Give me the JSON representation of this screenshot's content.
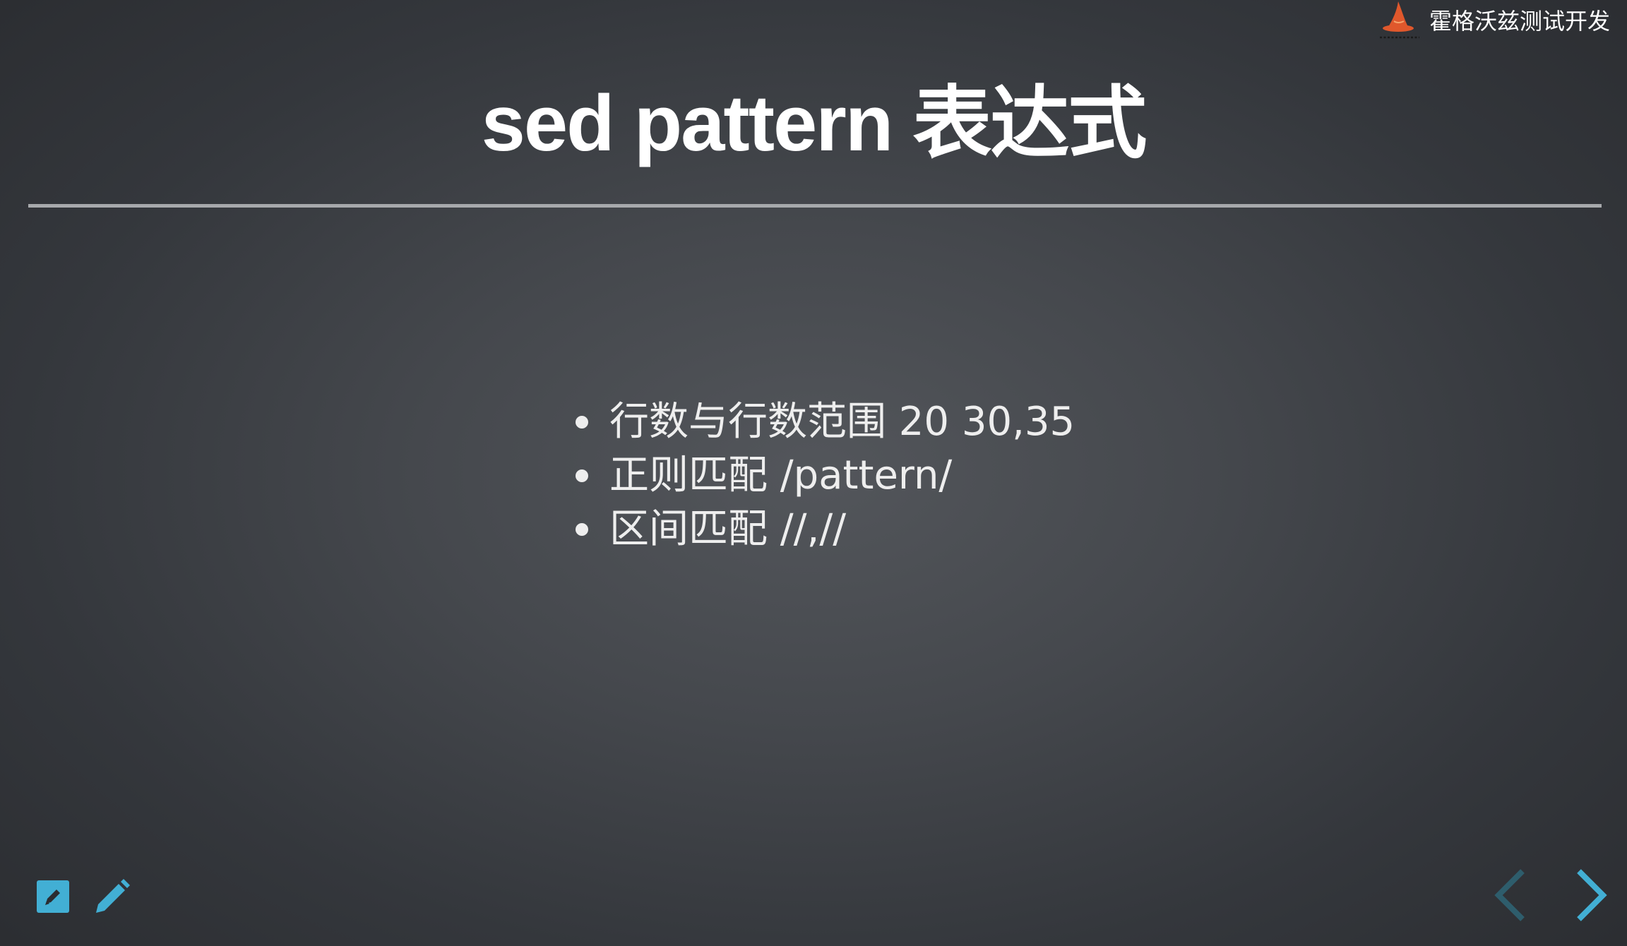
{
  "brand": {
    "name": "霍格沃兹测试开发",
    "logo_icon": "wizard-hat-icon"
  },
  "slide": {
    "title": "sed pattern 表达式",
    "bullets": [
      "行数与行数范围 20 30,35",
      "正则匹配 /pattern/",
      "区间匹配 //,//"
    ]
  },
  "controls": {
    "notes_icon": "notes-edit-icon",
    "pen_icon": "pencil-icon",
    "prev_icon": "chevron-left-icon",
    "next_icon": "chevron-right-icon"
  },
  "colors": {
    "accent": "#42afd4",
    "accent_disabled": "#2e5d6c",
    "text": "#eeeeee",
    "logo_orange": "#e0582c"
  }
}
